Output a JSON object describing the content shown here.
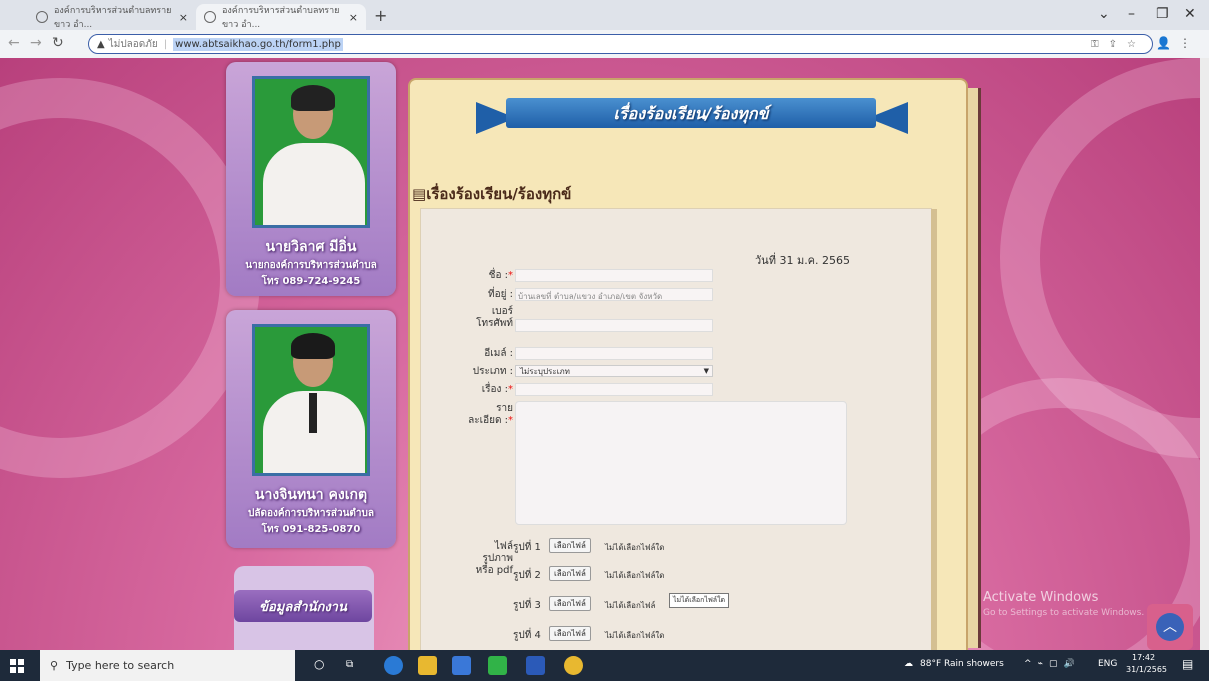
{
  "browser": {
    "tabs": [
      {
        "title": "องค์การบริหารส่วนตำบลทรายขาว อำ..."
      },
      {
        "title": "องค์การบริหารส่วนตำบลทรายขาว อำ..."
      }
    ],
    "new_tab": "+",
    "close": "×",
    "insecure_label": "ไม่ปลอดภัย",
    "url": "www.abtsaikhao.go.th/form1.php"
  },
  "sidebar": {
    "person1": {
      "name": "นายวิลาศ มีอิ่น",
      "title": "นายกองค์การบริหารส่วนตำบล",
      "phone": "โทร 089-724-9245"
    },
    "person2": {
      "name": "นางจินทนา คงเกตุ",
      "title": "ปลัดองค์การบริหารส่วนตำบล",
      "phone": "โทร 091-825-0870"
    },
    "info_banner": "ข้อมูลสำนักงาน"
  },
  "content": {
    "banner_title": "เรื่องร้องเรียน/ร้องทุกข์",
    "page_title": "เรื่องร้องเรียน/ร้องทุกข์",
    "date": "วันที่ 31 ม.ค. 2565",
    "form": {
      "name_label": "ชื่อ :",
      "address_label": "ที่อยู่ :",
      "address_placeholder": "บ้านเลขที่ ตำบล/แขวง อำเภอ/เขต จังหวัด",
      "phone_label_1": "เบอร์",
      "phone_label_2": "โทรศัพท์",
      "email_label": "อีเมล์ :",
      "type_label": "ประเภท :",
      "type_value": "ไม่ระบุประเภท",
      "subject_label": "เรื่อง :",
      "detail_label_1": "ราย",
      "detail_label_2": "ละเอียด :",
      "req_mark": "*",
      "file_label_1": "ไฟล์",
      "file_label_2": "รูปภาพ",
      "file_label_3": "หรือ pdf",
      "file_rows": [
        {
          "label": "รูปที่ 1",
          "button": "เลือกไฟล์",
          "status": "ไม่ได้เลือกไฟล์ใด"
        },
        {
          "label": "รูปที่ 2",
          "button": "เลือกไฟล์",
          "status": "ไม่ได้เลือกไฟล์ใด"
        },
        {
          "label": "รูปที่ 3",
          "button": "เลือกไฟล์",
          "status": "ไม่ได้เลือกไฟล์"
        },
        {
          "label": "รูปที่ 4",
          "button": "เลือกไฟล์",
          "status": "ไม่ได้เลือกไฟล์ใด"
        }
      ],
      "tooltip": "ไม่ได้เลือกไฟล์ใด"
    }
  },
  "watermark": {
    "line1": "Activate Windows",
    "line2": "Go to Settings to activate Windows."
  },
  "taskbar": {
    "search_placeholder": "Type here to search",
    "weather": "88°F  Rain showers",
    "lang": "ENG",
    "time": "17:42",
    "date": "31/1/2565"
  }
}
